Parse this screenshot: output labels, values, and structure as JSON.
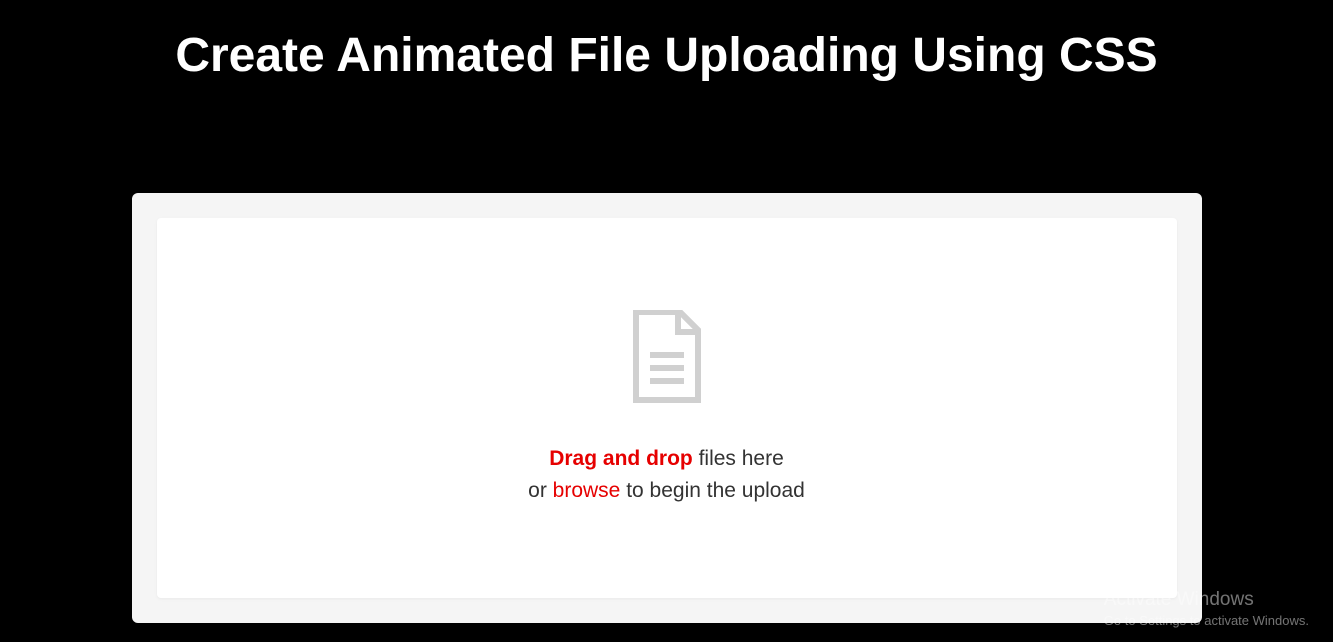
{
  "page": {
    "title": "Create Animated File Uploading Using CSS"
  },
  "upload": {
    "line1_highlight": "Drag and drop",
    "line1_rest": " files here",
    "line2_prefix": "or ",
    "line2_link": "browse",
    "line2_rest": " to begin the upload"
  },
  "watermark": {
    "title": "Activate Windows",
    "subtitle": "Go to Settings to activate Windows."
  }
}
